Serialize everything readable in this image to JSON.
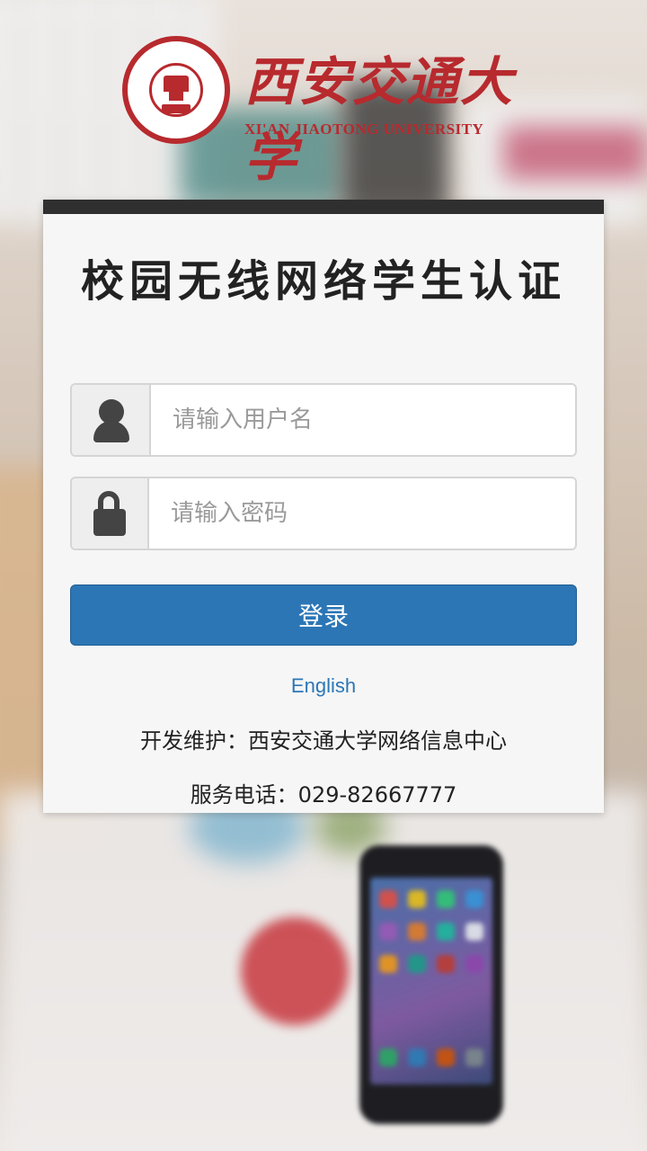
{
  "header": {
    "logo_cn": "西安交通大学",
    "logo_en": "XI'AN JIAOTONG UNIVERSITY"
  },
  "card": {
    "title": "校园无线网络学生认证",
    "username": {
      "placeholder": "请输入用户名",
      "value": ""
    },
    "password": {
      "placeholder": "请输入密码",
      "value": ""
    },
    "login_label": "登录",
    "language_link": "English",
    "maintainer": "开发维护：西安交通大学网络信息中心",
    "phone": "服务电话：029-82667777"
  },
  "colors": {
    "brand_red": "#b72a2e",
    "primary_blue": "#2c76b6",
    "card_top_bar": "#2f2f2f"
  },
  "icons": {
    "username_addon": "user-icon",
    "password_addon": "lock-icon"
  }
}
